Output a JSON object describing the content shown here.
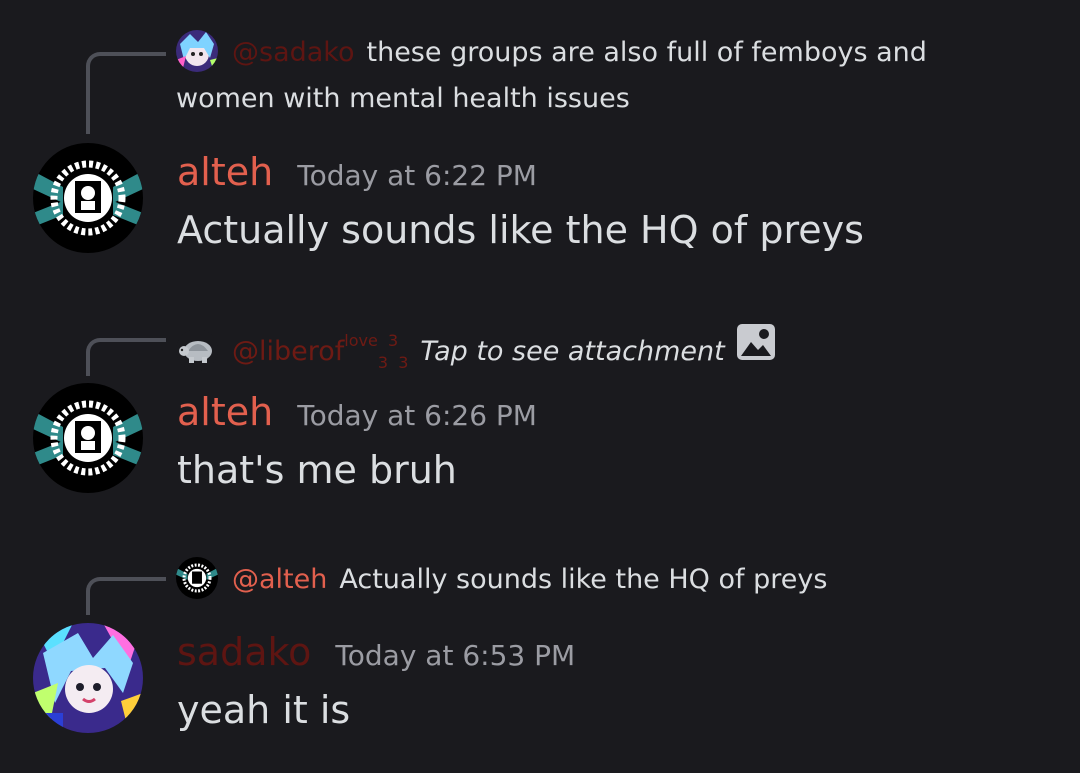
{
  "colors": {
    "background": "#1a1a1e",
    "alteh_name": "#e2604e",
    "sadako_name": "#5e1512",
    "liberof_name": "#6e1a14",
    "spine": "#4e5058",
    "timestamp": "#9b9ca3"
  },
  "messages": [
    {
      "reply": {
        "avatar_icon": "anime-avatar-icon",
        "mention": "@sadako",
        "text": "these groups are also full of femboys and women with mental health issues"
      },
      "avatar_icon": "wreath-logo-avatar-icon",
      "username": "alteh",
      "timestamp": "Today at 6:22 PM",
      "content": "Actually sounds like the HQ of preys"
    },
    {
      "reply": {
        "avatar_icon": "turtle-avatar-icon",
        "mention_main": "@liberof",
        "mention_sup": "love",
        "mention_sub1": "3",
        "mention_sup2": "3",
        "mention_sub2": "3",
        "text": "Tap to see attachment",
        "attachment_icon": "image-icon"
      },
      "avatar_icon": "wreath-logo-avatar-icon",
      "username": "alteh",
      "timestamp": "Today at 6:26 PM",
      "content": "that's me bruh"
    },
    {
      "reply": {
        "avatar_icon": "wreath-logo-avatar-icon",
        "mention": "@alteh",
        "text": "Actually sounds like the HQ of preys"
      },
      "avatar_icon": "anime-avatar-icon",
      "username": "sadako",
      "timestamp": "Today at 6:53 PM",
      "content": "yeah it is"
    }
  ]
}
